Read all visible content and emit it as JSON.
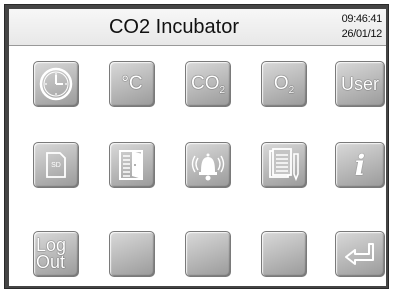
{
  "header": {
    "title": "CO2 Incubator",
    "time": "09:46:41",
    "date": "26/01/12"
  },
  "buttons": {
    "temperature_label": "°C",
    "co2_label": "CO",
    "co2_sub": "2",
    "o2_label": "O",
    "o2_sub": "2",
    "user_label": "User",
    "sd_label": "SD",
    "info_label": "i",
    "logout_line1": "Log",
    "logout_line2": "Out"
  },
  "icons": {
    "clock": "clock-icon",
    "sd": "sd-card-icon",
    "door": "door-icon",
    "alarm": "alarm-bell-icon",
    "log": "log-notes-icon",
    "info": "info-icon",
    "enter": "enter-return-icon"
  }
}
